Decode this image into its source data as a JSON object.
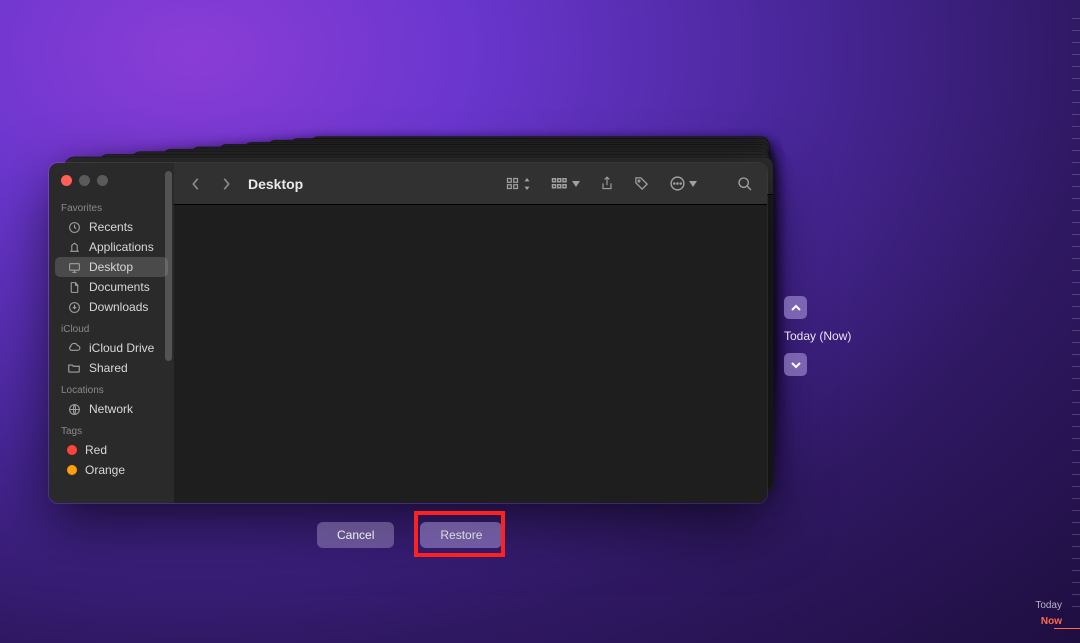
{
  "window_title": "Desktop",
  "sidebar": {
    "sections": {
      "favorites": "Favorites",
      "icloud": "iCloud",
      "locations": "Locations",
      "tags": "Tags"
    },
    "favorites": [
      {
        "label": "Recents",
        "icon": "clock"
      },
      {
        "label": "Applications",
        "icon": "apps"
      },
      {
        "label": "Desktop",
        "icon": "desktop",
        "active": true
      },
      {
        "label": "Documents",
        "icon": "doc"
      },
      {
        "label": "Downloads",
        "icon": "download"
      }
    ],
    "icloud": [
      {
        "label": "iCloud Drive",
        "icon": "cloud"
      },
      {
        "label": "Shared",
        "icon": "shared"
      }
    ],
    "locations": [
      {
        "label": "Network",
        "icon": "globe"
      }
    ],
    "tags": [
      {
        "label": "Red",
        "color": "red"
      },
      {
        "label": "Orange",
        "color": "orange"
      }
    ]
  },
  "nav": {
    "current_time": "Today (Now)"
  },
  "buttons": {
    "cancel": "Cancel",
    "restore": "Restore"
  },
  "timeline": {
    "today_label": "Today",
    "now_label": "Now"
  }
}
